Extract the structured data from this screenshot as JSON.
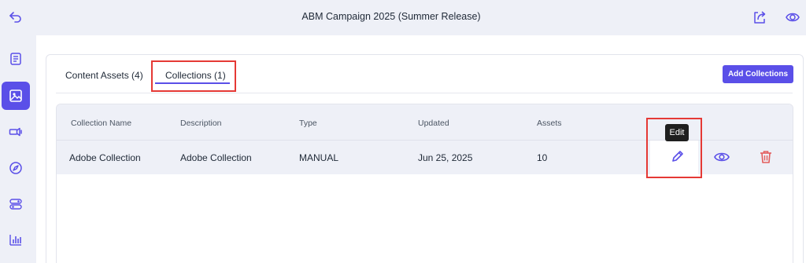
{
  "header": {
    "title": "ABM Campaign 2025 (Summer Release)",
    "back_icon": "undo-arrow-icon",
    "share_icon": "share-icon",
    "preview_icon": "eye-icon"
  },
  "sidebar": {
    "items": [
      {
        "icon": "document-icon",
        "active": false
      },
      {
        "icon": "image-icon",
        "active": true
      },
      {
        "icon": "channel-icon",
        "active": false
      },
      {
        "icon": "compass-icon",
        "active": false
      },
      {
        "icon": "toggle-icon",
        "active": false
      },
      {
        "icon": "bar-chart-icon",
        "active": false
      }
    ]
  },
  "tabs": [
    {
      "label": "Content Assets (4)",
      "active": false
    },
    {
      "label": "Collections (1)",
      "active": true
    }
  ],
  "add_button_label": "Add Collections",
  "table": {
    "columns": [
      "Collection Name",
      "Description",
      "Type",
      "Updated",
      "Assets"
    ],
    "rows": [
      {
        "name": "Adobe Collection",
        "description": "Adobe Collection",
        "type": "MANUAL",
        "updated": "Jun 25, 2025",
        "assets": "10"
      }
    ]
  },
  "tooltip": "Edit",
  "colors": {
    "accent": "#5a4fe8",
    "delete": "#e35d5d",
    "highlight": "#e53935"
  }
}
